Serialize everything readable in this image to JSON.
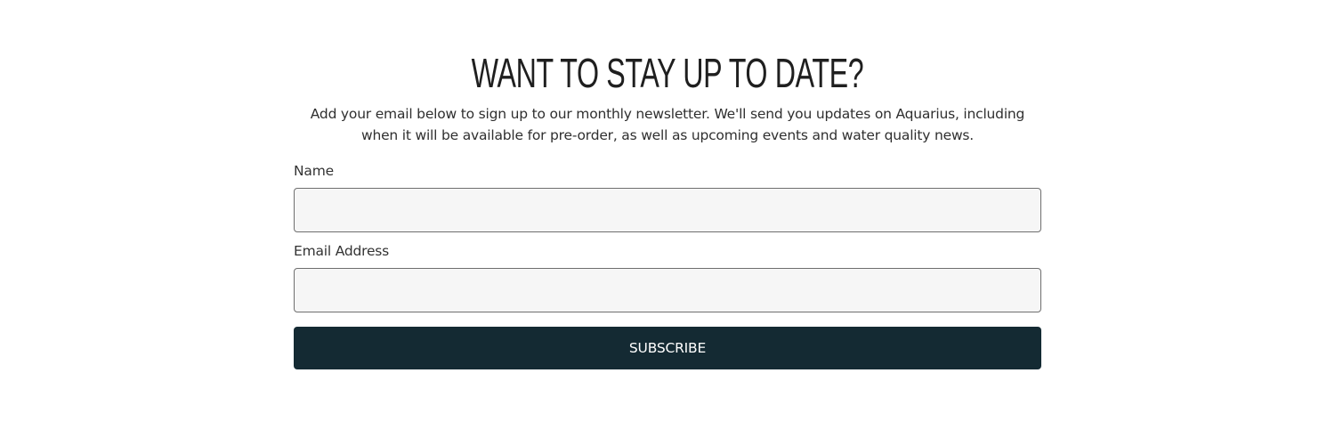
{
  "newsletter": {
    "title": "WANT TO STAY UP TO DATE?",
    "intro": "Add your email below to sign up to our monthly newsletter. We'll send you updates on Aquarius, including when it will be available for pre-order, as well as upcoming events and water quality news.",
    "fields": {
      "name_label": "Name",
      "name_value": "",
      "email_label": "Email Address",
      "email_value": ""
    },
    "subscribe_label": "SUBSCRIBE"
  },
  "colors": {
    "button_bg": "#142a33",
    "button_text": "#ffffff",
    "input_bg": "#f6f6f6",
    "input_border": "#6f6f6f",
    "text": "#2a2a2a"
  }
}
